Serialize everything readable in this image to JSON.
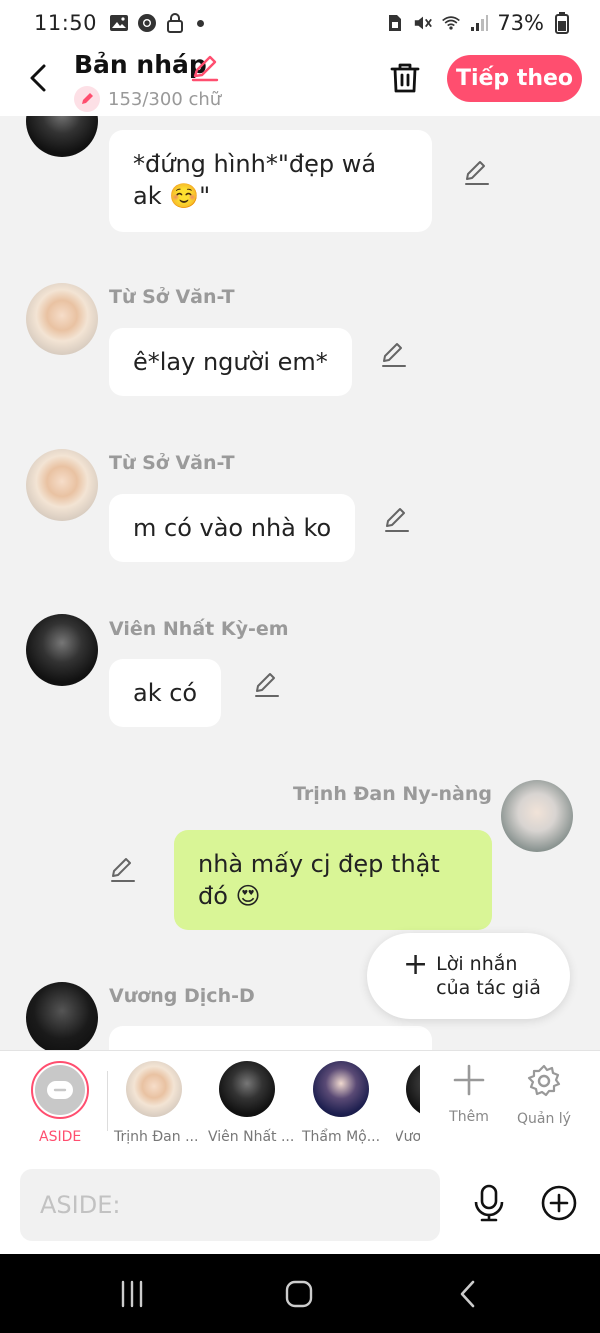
{
  "status_bar": {
    "time": "11:50",
    "battery": "73%",
    "icons": [
      "image-icon",
      "chrome-icon",
      "lock-icon",
      "dot",
      "sim-icon",
      "mute-icon",
      "wifi-icon",
      "signal-icon",
      "battery-icon"
    ]
  },
  "header": {
    "title": "Bản nháp",
    "word_count": "153/300 chữ",
    "next_label": "Tiếp theo"
  },
  "messages": [
    {
      "name": "",
      "text": "*đứng hình*\"đẹp wá ak ☺️\"",
      "side": "left"
    },
    {
      "name": "Từ Sở Văn-T",
      "text": "ê*lay người em*",
      "side": "left"
    },
    {
      "name": "Từ Sở Văn-T",
      "text": "m có vào nhà ko",
      "side": "left"
    },
    {
      "name": "Viên Nhất Kỳ-em",
      "text": "ak có",
      "side": "left"
    },
    {
      "name": "Trịnh Đan Ny-nàng",
      "text": "nhà mấy cj đẹp thật đó 😍",
      "side": "right"
    },
    {
      "name": "Vương Dịch-D",
      "text": "",
      "side": "left"
    }
  ],
  "author_note": {
    "plus": "+",
    "label_line1": "Lời nhắn",
    "label_line2": "của tác giả"
  },
  "tray": {
    "aside_label": "ASIDE",
    "characters": [
      "Trịnh Đan ...",
      "Viên Nhất ...",
      "Thẩm Mộ...",
      "Vươ"
    ],
    "add_label": "Thêm",
    "manage_label": "Quản lý"
  },
  "input": {
    "placeholder": "ASIDE:"
  },
  "colors": {
    "accent": "#ff4e6f",
    "right_bubble": "#d9f596",
    "left_bubble": "#ffffff",
    "background": "#f2f2f2"
  }
}
